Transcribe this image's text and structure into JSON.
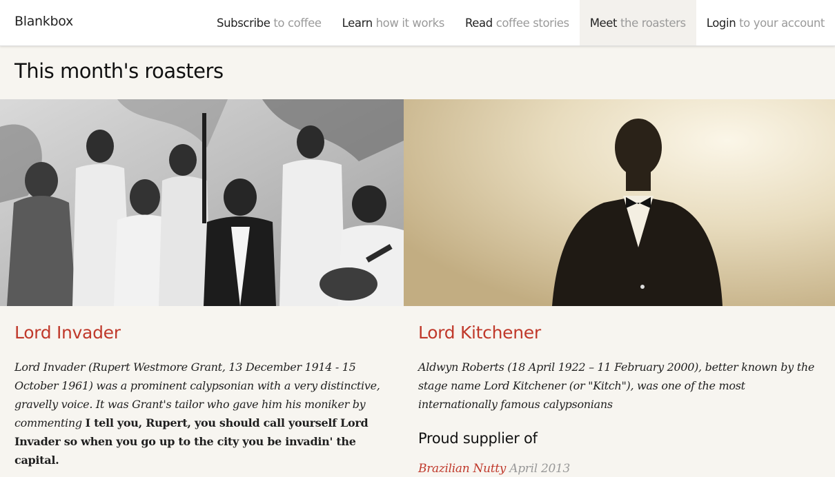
{
  "header": {
    "brand": "Blankbox",
    "nav": [
      {
        "verb": "Subscribe",
        "rest": "to coffee"
      },
      {
        "verb": "Learn",
        "rest": "how it works"
      },
      {
        "verb": "Read",
        "rest": "coffee stories"
      },
      {
        "verb": "Meet",
        "rest": "the roasters"
      },
      {
        "verb": "Login",
        "rest": "to your account"
      }
    ]
  },
  "main": {
    "title": "This month's roasters",
    "roasters": [
      {
        "name": "Lord Invader",
        "bio_intro": "Lord Invader (Rupert Westmore Grant, 13 December 1914 - 15 October 1961) was a prominent calypsonian with a very distinctive, gravelly voice. It was Grant's tailor who gave him his moniker by commenting",
        "bio_quote": "I tell you, Rupert, you should call yourself Lord Invader so when you go up to the city you be invadin' the capital."
      },
      {
        "name": "Lord Kitchener",
        "bio": "Aldwyn Roberts (18 April 1922 – 11 February 2000), better known by the stage name Lord Kitchener (or \"Kitch\"), was one of the most internationally famous calypsonians",
        "supplier_heading": "Proud supplier of",
        "supplies": [
          {
            "coffee": "Brazilian Nutty",
            "date": "April 2013"
          }
        ]
      }
    ]
  },
  "colors": {
    "accent": "#c0392b",
    "background": "#f7f5f0",
    "muted": "#9a9a9a"
  }
}
